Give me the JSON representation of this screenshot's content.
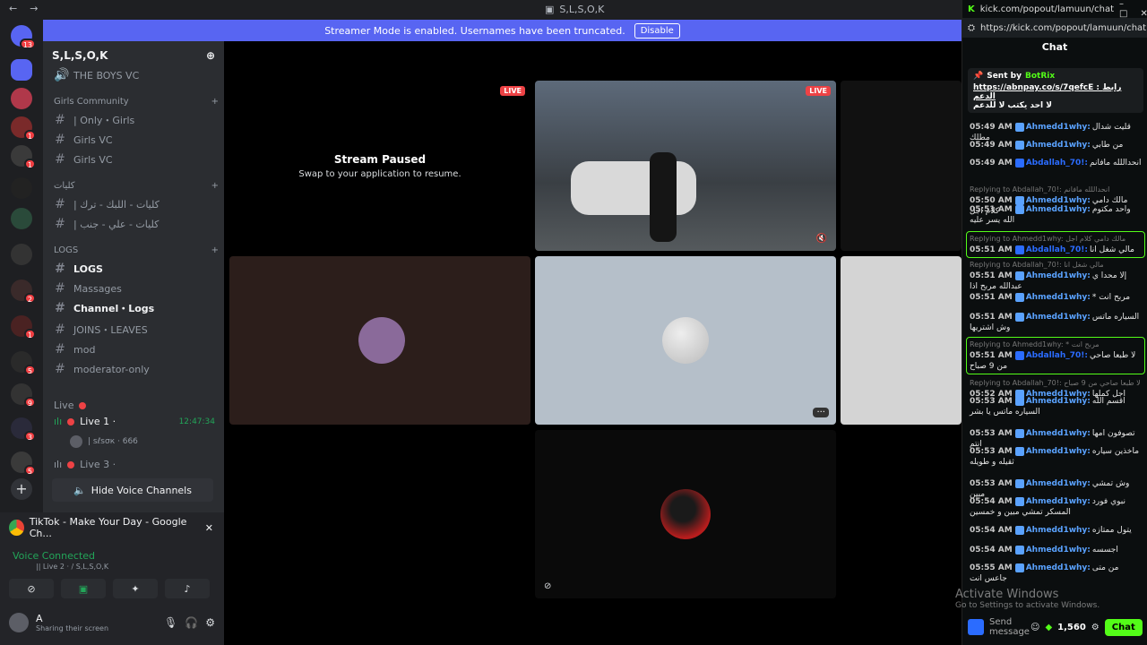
{
  "window_title": "S,L,S,O,K",
  "streamer_banner": {
    "text": "Streamer Mode is enabled. Usernames have been truncated.",
    "button": "Disable"
  },
  "server": {
    "name": "S,L,S,O,K"
  },
  "channels": {
    "top": "THE BOYS VC",
    "girls_cat": "Girls Community",
    "girls_items": [
      "| Only・Girls",
      "Girls VC",
      "Girls VC"
    ],
    "cat2": "كليات",
    "cat2_items": [
      "| كليات - اللبك - ترك",
      "| كليات - علي - جنب"
    ],
    "logs_cat": "LOGS",
    "logs_items": [
      "LOGS",
      "Massages",
      "Channel・Logs",
      "JOINS・LEAVES",
      "mod",
      "moderator-only"
    ],
    "live_cat": "Live",
    "live1": "Live 1 ·",
    "live1_time": "12:47:34",
    "live1_user": "| ѕℓѕσк · 666",
    "live3": "Live 3 ·",
    "hide_vc": "Hide Voice Channels"
  },
  "panel": {
    "tiktok": "TikTok - Make Your Day - Google Ch...",
    "voice_connected": "Voice Connected",
    "voice_sub": "|| Live 2 · / S,L,S,O,K",
    "user_name": "A",
    "user_status": "Sharing their screen"
  },
  "stage": {
    "paused_title": "Stream Paused",
    "paused_sub": "Swap to your application to resume.",
    "live": "LIVE"
  },
  "kick": {
    "title": "kick.com/popout/lamuun/chat",
    "url": "https://kick.com/popout/lamuun/chat",
    "header": "Chat",
    "pinned_by": "Sent by",
    "pinned_user": "BotRix",
    "pinned_text": "https://abnpay.co/s/7qefcE : رابط الدعم",
    "pinned_text2": "لا احد يكتب لا للدعم",
    "messages": [
      {
        "time": "05:49 AM",
        "user": "Ahmedd1why:",
        "text": "قليت شدال مطلك",
        "color": "#5aa2ff"
      },
      {
        "time": "05:49 AM",
        "user": "Ahmedd1why:",
        "text": "من طابي",
        "color": "#5aa2ff"
      },
      {
        "time": "05:49 AM",
        "user": "Abdallah_70!:",
        "text": "انحداللله مافانم",
        "color": "#2b6cff"
      },
      {
        "reply": "Replying to Abdallah_70!: انحداللله مافانم",
        "time": "05:50 AM",
        "user": "Ahmedd1why:",
        "text": "مالك دامي كلام اجل",
        "color": "#5aa2ff"
      },
      {
        "time": "05:51 AM",
        "user": "Ahmedd1why:",
        "text": "واحد مكتوم الله يسر عليه",
        "color": "#5aa2ff"
      },
      {
        "reply": "Replying to Ahmedd1why: مالك دامي كلام اجل",
        "time": "05:51 AM",
        "user": "Abdallah_70!:",
        "text": "مالي شغل انا",
        "color": "#2b6cff"
      },
      {
        "reply": "Replying to Abdallah_70!: مالي شغل انا",
        "time": "05:51 AM",
        "user": "Ahmedd1why:",
        "text": "إلا محدا ي عبدالله مربح اذا",
        "color": "#5aa2ff"
      },
      {
        "time": "05:51 AM",
        "user": "Ahmedd1why:",
        "text": "* مربح انت",
        "color": "#5aa2ff"
      },
      {
        "time": "05:51 AM",
        "user": "Ahmedd1why:",
        "text": "السياره ماتس وش اشتريها",
        "color": "#5aa2ff"
      },
      {
        "reply": "Replying to Ahmedd1why: * مربح انت",
        "time": "05:51 AM",
        "user": "Abdallah_70!:",
        "text": "لا طبعا صاحي من 9 صباح",
        "color": "#2b6cff"
      },
      {
        "reply": "Replying to Abdallah_70!: لا طبعا صاحي من 9 صباح",
        "time": "05:52 AM",
        "user": "Ahmedd1why:",
        "text": "اجل كملها",
        "color": "#5aa2ff"
      },
      {
        "time": "05:53 AM",
        "user": "Ahmedd1why:",
        "text": "اقسم الله السياره ماتس يا بشر",
        "color": "#5aa2ff"
      },
      {
        "time": "05:53 AM",
        "user": "Ahmedd1why:",
        "text": "تصوفون امها انتم",
        "color": "#5aa2ff"
      },
      {
        "time": "05:53 AM",
        "user": "Ahmedd1why:",
        "text": "ماخذين سياره ثقيله و طويله",
        "color": "#5aa2ff"
      },
      {
        "time": "05:53 AM",
        "user": "Ahmedd1why:",
        "text": "وش تمشي مبين",
        "color": "#5aa2ff"
      },
      {
        "time": "05:54 AM",
        "user": "Ahmedd1why:",
        "text": "نبوي فورد المسكر تمشي مبين و خمسين",
        "color": "#5aa2ff"
      },
      {
        "time": "05:54 AM",
        "user": "Ahmedd1why:",
        "text": "يتول ممتازه",
        "color": "#5aa2ff"
      },
      {
        "time": "05:54 AM",
        "user": "Ahmedd1why:",
        "text": "اجسسه",
        "color": "#5aa2ff"
      },
      {
        "time": "05:55 AM",
        "user": "Ahmedd1why:",
        "text": "من متى جاعس انت",
        "color": "#5aa2ff"
      }
    ],
    "send_label": "Send message",
    "points": "1,560",
    "chat_button": "Chat"
  },
  "watermark": {
    "line1": "Activate Windows",
    "line2": "Go to Settings to activate Windows."
  }
}
